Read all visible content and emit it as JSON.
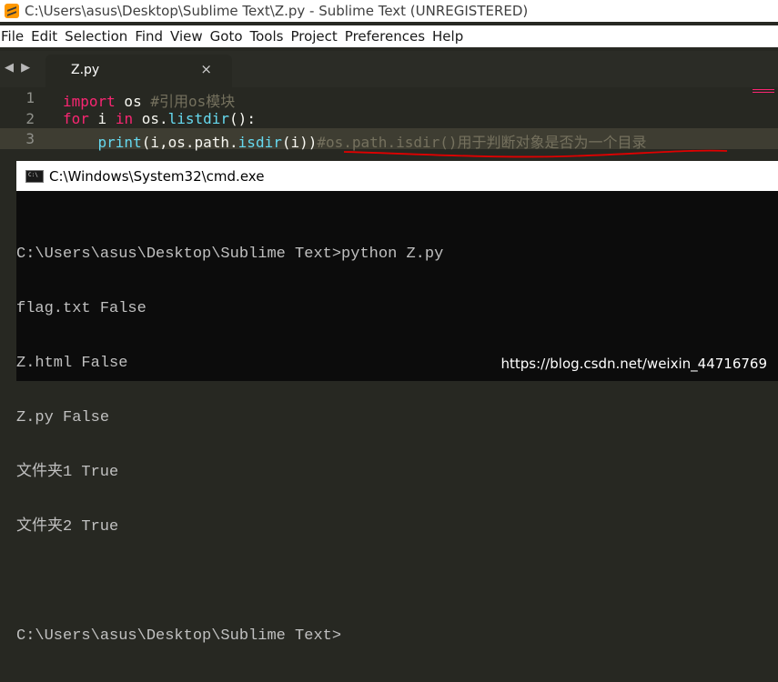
{
  "sublime": {
    "title": "C:\\Users\\asus\\Desktop\\Sublime Text\\Z.py - Sublime Text (UNREGISTERED)",
    "menu": [
      "File",
      "Edit",
      "Selection",
      "Find",
      "View",
      "Goto",
      "Tools",
      "Project",
      "Preferences",
      "Help"
    ],
    "tab": {
      "label": "Z.py",
      "close_glyph": "×"
    },
    "tab_nav_glyph": "◀ ▶",
    "line_numbers": [
      "1",
      "2",
      "3"
    ],
    "code": {
      "line1": {
        "kw": "import",
        "mod": " os ",
        "comment": "#引用os模块"
      },
      "line2": {
        "kw": "for",
        "pre": " i ",
        "kw2": "in",
        "mid": " os.",
        "fn": "listdir",
        "post": "():"
      },
      "line3": {
        "indent": "    ",
        "fn1": "print",
        "a": "(i,os.path.",
        "fn2": "isdir",
        "b": "(i))",
        "comment": "#os.path.isdir()用于判断对象是否为一个目录"
      }
    },
    "annotation_color": "#e00000"
  },
  "cmd": {
    "title": "C:\\Windows\\System32\\cmd.exe",
    "lines": [
      "C:\\Users\\asus\\Desktop\\Sublime Text>python Z.py",
      "flag.txt False",
      "Z.html False",
      "Z.py False",
      "文件夹1 True",
      "文件夹2 True",
      "",
      "C:\\Users\\asus\\Desktop\\Sublime Text>"
    ],
    "watermark": "https://blog.csdn.net/weixin_44716769"
  },
  "colors": {
    "keyword": "#f92672",
    "function": "#66d9ef",
    "comment": "#75715e",
    "editor_bg": "#272822",
    "cmd_bg": "#0c0c0c"
  }
}
